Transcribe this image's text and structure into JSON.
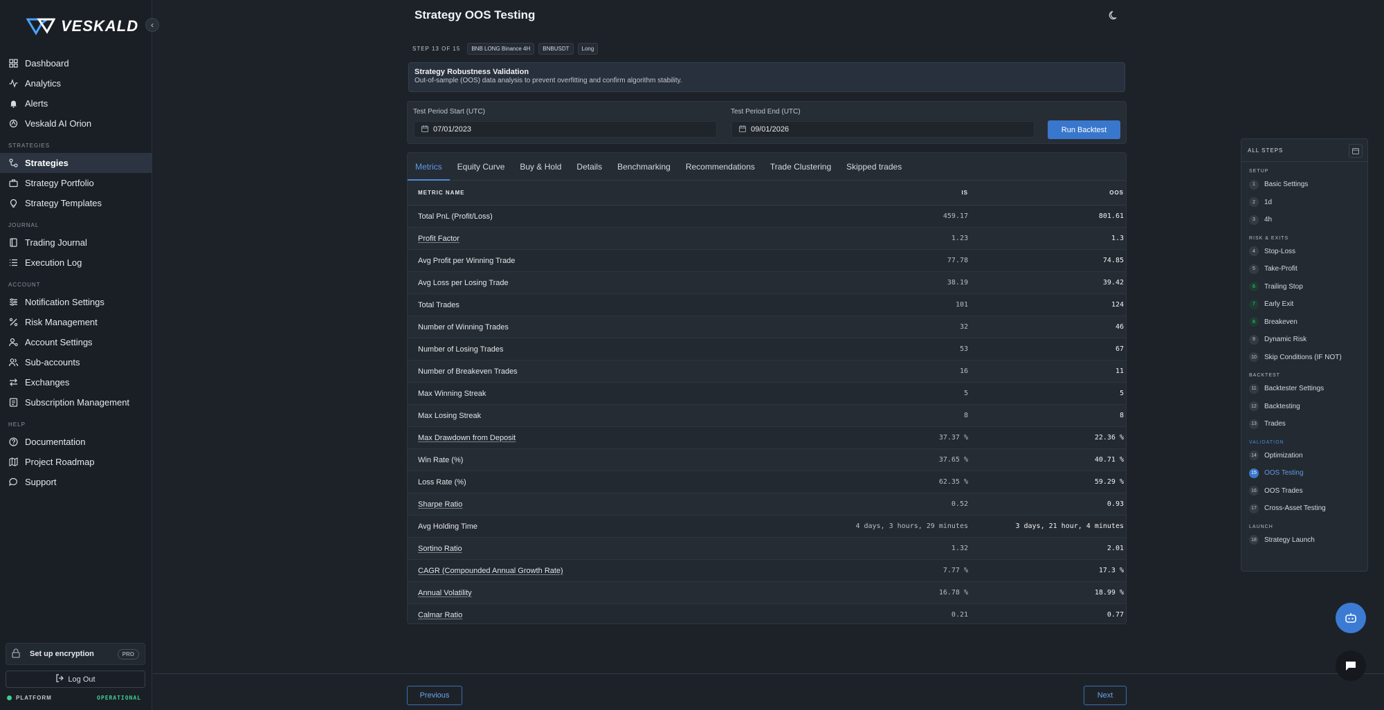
{
  "brand": {
    "name": "VESKALD",
    "logo_icon": "veskald-logo-mark"
  },
  "sidebar": {
    "collapse_icon": "chevron-left-icon",
    "main_items": [
      {
        "label": "Dashboard",
        "icon": "grid-icon"
      },
      {
        "label": "Analytics",
        "icon": "activity-icon"
      },
      {
        "label": "Alerts",
        "icon": "bell-icon"
      },
      {
        "label": "Veskald AI Orion",
        "icon": "ai-icon"
      }
    ],
    "sections": [
      {
        "title": "STRATEGIES",
        "items": [
          {
            "label": "Strategies",
            "icon": "strategy-icon",
            "active": true
          },
          {
            "label": "Strategy Portfolio",
            "icon": "briefcase-icon"
          },
          {
            "label": "Strategy Templates",
            "icon": "lightbulb-icon"
          }
        ]
      },
      {
        "title": "JOURNAL",
        "items": [
          {
            "label": "Trading Journal",
            "icon": "book-icon"
          },
          {
            "label": "Execution Log",
            "icon": "list-icon"
          }
        ]
      },
      {
        "title": "ACCOUNT",
        "items": [
          {
            "label": "Notification Settings",
            "icon": "sliders-icon"
          },
          {
            "label": "Risk Management",
            "icon": "percent-icon"
          },
          {
            "label": "Account Settings",
            "icon": "user-gear-icon"
          },
          {
            "label": "Sub-accounts",
            "icon": "users-icon"
          },
          {
            "label": "Exchanges",
            "icon": "swap-icon"
          },
          {
            "label": "Subscription Management",
            "icon": "receipt-icon"
          }
        ]
      },
      {
        "title": "HELP",
        "items": [
          {
            "label": "Documentation",
            "icon": "help-circle-icon"
          },
          {
            "label": "Project Roadmap",
            "icon": "map-icon"
          },
          {
            "label": "Support",
            "icon": "chat-bubble-icon"
          }
        ]
      }
    ],
    "encryption": {
      "label": "Set up encryption",
      "badge": "PRO"
    },
    "logout_label": "Log Out",
    "platform_label": "PLATFORM",
    "platform_status": "OPERATIONAL",
    "status_color": "#3ecf8e"
  },
  "header": {
    "title": "Strategy OOS Testing",
    "theme_icon": "moon-icon"
  },
  "step_info": {
    "label": "STEP 13 OF 15",
    "chips": [
      "BNB LONG Binance 4H",
      "BNBUSDT",
      "Long"
    ]
  },
  "validation": {
    "title": "Strategy Robustness Validation",
    "description": "Out-of-sample (OOS) data analysis to prevent overfitting and confirm algorithm stability."
  },
  "period": {
    "start_label": "Test Period Start (UTC)",
    "start_value": "07/01/2023",
    "end_label": "Test Period End (UTC)",
    "end_value": "09/01/2026",
    "run_label": "Run Backtest"
  },
  "tabs": [
    "Metrics",
    "Equity Curve",
    "Buy & Hold",
    "Details",
    "Benchmarking",
    "Recommendations",
    "Trade Clustering",
    "Skipped trades"
  ],
  "active_tab": "Metrics",
  "table": {
    "headers": {
      "name": "METRIC NAME",
      "is": "IS",
      "oos": "OOS"
    },
    "rows": [
      {
        "name": "Total PnL (Profit/Loss)",
        "is": "459.17",
        "oos": "801.61",
        "link": false
      },
      {
        "name": "Profit Factor",
        "is": "1.23",
        "oos": "1.3",
        "link": true
      },
      {
        "name": "Avg Profit per Winning Trade",
        "is": "77.78",
        "oos": "74.85",
        "link": false
      },
      {
        "name": "Avg Loss per Losing Trade",
        "is": "38.19",
        "oos": "39.42",
        "link": false
      },
      {
        "name": "Total Trades",
        "is": "101",
        "oos": "124",
        "link": false
      },
      {
        "name": "Number of Winning Trades",
        "is": "32",
        "oos": "46",
        "link": false
      },
      {
        "name": "Number of Losing Trades",
        "is": "53",
        "oos": "67",
        "link": false
      },
      {
        "name": "Number of Breakeven Trades",
        "is": "16",
        "oos": "11",
        "link": false
      },
      {
        "name": "Max Winning Streak",
        "is": "5",
        "oos": "5",
        "link": false
      },
      {
        "name": "Max Losing Streak",
        "is": "8",
        "oos": "8",
        "link": false
      },
      {
        "name": "Max Drawdown from Deposit",
        "is": "37.37 %",
        "oos": "22.36 %",
        "link": true
      },
      {
        "name": "Win Rate (%)",
        "is": "37.65 %",
        "oos": "40.71 %",
        "link": false
      },
      {
        "name": "Loss Rate (%)",
        "is": "62.35 %",
        "oos": "59.29 %",
        "link": false
      },
      {
        "name": "Sharpe Ratio",
        "is": "0.52",
        "oos": "0.93",
        "link": true
      },
      {
        "name": "Avg Holding Time",
        "is": "4 days, 3 hours, 29 minutes",
        "oos": "3 days, 21 hour, 4 minutes",
        "link": false
      },
      {
        "name": "Sortino Ratio",
        "is": "1.32",
        "oos": "2.01",
        "link": true
      },
      {
        "name": "CAGR (Compounded Annual Growth Rate)",
        "is": "7.77 %",
        "oos": "17.3 %",
        "link": true
      },
      {
        "name": "Annual Volatility",
        "is": "16.78 %",
        "oos": "18.99 %",
        "link": true
      },
      {
        "name": "Calmar Ratio",
        "is": "0.21",
        "oos": "0.77",
        "link": true
      }
    ]
  },
  "footer": {
    "previous_label": "Previous",
    "next_label": "Next"
  },
  "steps_panel": {
    "title": "ALL STEPS",
    "toggle_icon": "calendar-icon",
    "groups": [
      {
        "title": "SETUP",
        "highlight": false,
        "items": [
          {
            "num": "1",
            "label": "Basic Settings"
          },
          {
            "num": "2",
            "label": "1d"
          },
          {
            "num": "3",
            "label": "4h"
          }
        ]
      },
      {
        "title": "RISK & EXITS",
        "highlight": false,
        "items": [
          {
            "num": "4",
            "label": "Stop-Loss"
          },
          {
            "num": "5",
            "label": "Take-Profit"
          },
          {
            "num": "6",
            "label": "Trailing Stop",
            "green": true
          },
          {
            "num": "7",
            "label": "Early Exit",
            "green": true
          },
          {
            "num": "8",
            "label": "Breakeven",
            "green": true
          },
          {
            "num": "9",
            "label": "Dynamic Risk"
          },
          {
            "num": "10",
            "label": "Skip Conditions (IF NOT)"
          }
        ]
      },
      {
        "title": "BACKTEST",
        "highlight": false,
        "items": [
          {
            "num": "11",
            "label": "Backtester Settings"
          },
          {
            "num": "12",
            "label": "Backtesting"
          },
          {
            "num": "13",
            "label": "Trades"
          }
        ]
      },
      {
        "title": "VALIDATION",
        "highlight": true,
        "items": [
          {
            "num": "14",
            "label": "Optimization"
          },
          {
            "num": "15",
            "label": "OOS Testing",
            "active": true
          },
          {
            "num": "16",
            "label": "OOS Trades"
          },
          {
            "num": "17",
            "label": "Cross-Asset Testing"
          }
        ]
      },
      {
        "title": "LAUNCH",
        "highlight": false,
        "items": [
          {
            "num": "18",
            "label": "Strategy Launch"
          }
        ]
      }
    ]
  },
  "fab": {
    "assistant_icon": "robot-icon",
    "chat_icon": "chat-icon"
  },
  "colors": {
    "accent": "#3977cc",
    "active_tab": "#5b9be6",
    "background": "#1d2229"
  }
}
